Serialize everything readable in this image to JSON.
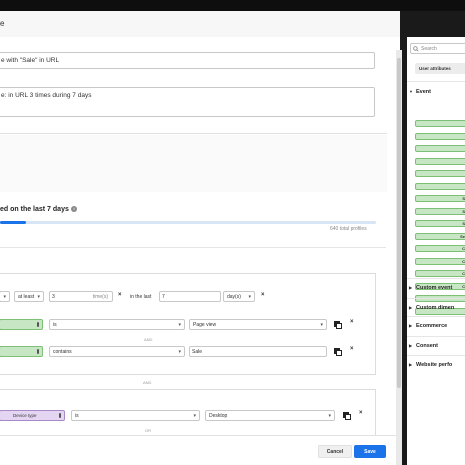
{
  "title": "e",
  "segment": {
    "name": "e with \"Sale\" in URL",
    "description": "e: in URL 3 times during 7 days"
  },
  "estimate": {
    "label": "ed on the last 7 days",
    "total_profiles": "640 total profiles",
    "progress_fraction": 0.07
  },
  "condition1": {
    "operator": "at least",
    "count": "3",
    "count_unit": "time(s)",
    "in_the_last": "in the last",
    "days": "7",
    "days_unit": "day(s)",
    "rows": [
      {
        "operator": "is",
        "value": "Page view"
      },
      {
        "operator": "contains",
        "value": "Sale"
      }
    ],
    "and_label": "AND"
  },
  "outer_and": "AND",
  "condition2": {
    "dimension": "Device type",
    "operator": "is",
    "value": "Desktop",
    "or_label": "OR"
  },
  "footer": {
    "cancel": "Cancel",
    "save": "Save"
  },
  "panel": {
    "search_placeholder": "Search",
    "user_attributes": "User attributes",
    "event_category": "Event",
    "event_pills": [
      "",
      "",
      "",
      "",
      "",
      "",
      "S",
      "S",
      "S",
      "Se",
      "C",
      "C",
      "C",
      "C",
      "",
      ""
    ],
    "categories": [
      "Custom event",
      "Custom dimen",
      "Ecommerce",
      "Consent",
      "Website perfo"
    ]
  }
}
